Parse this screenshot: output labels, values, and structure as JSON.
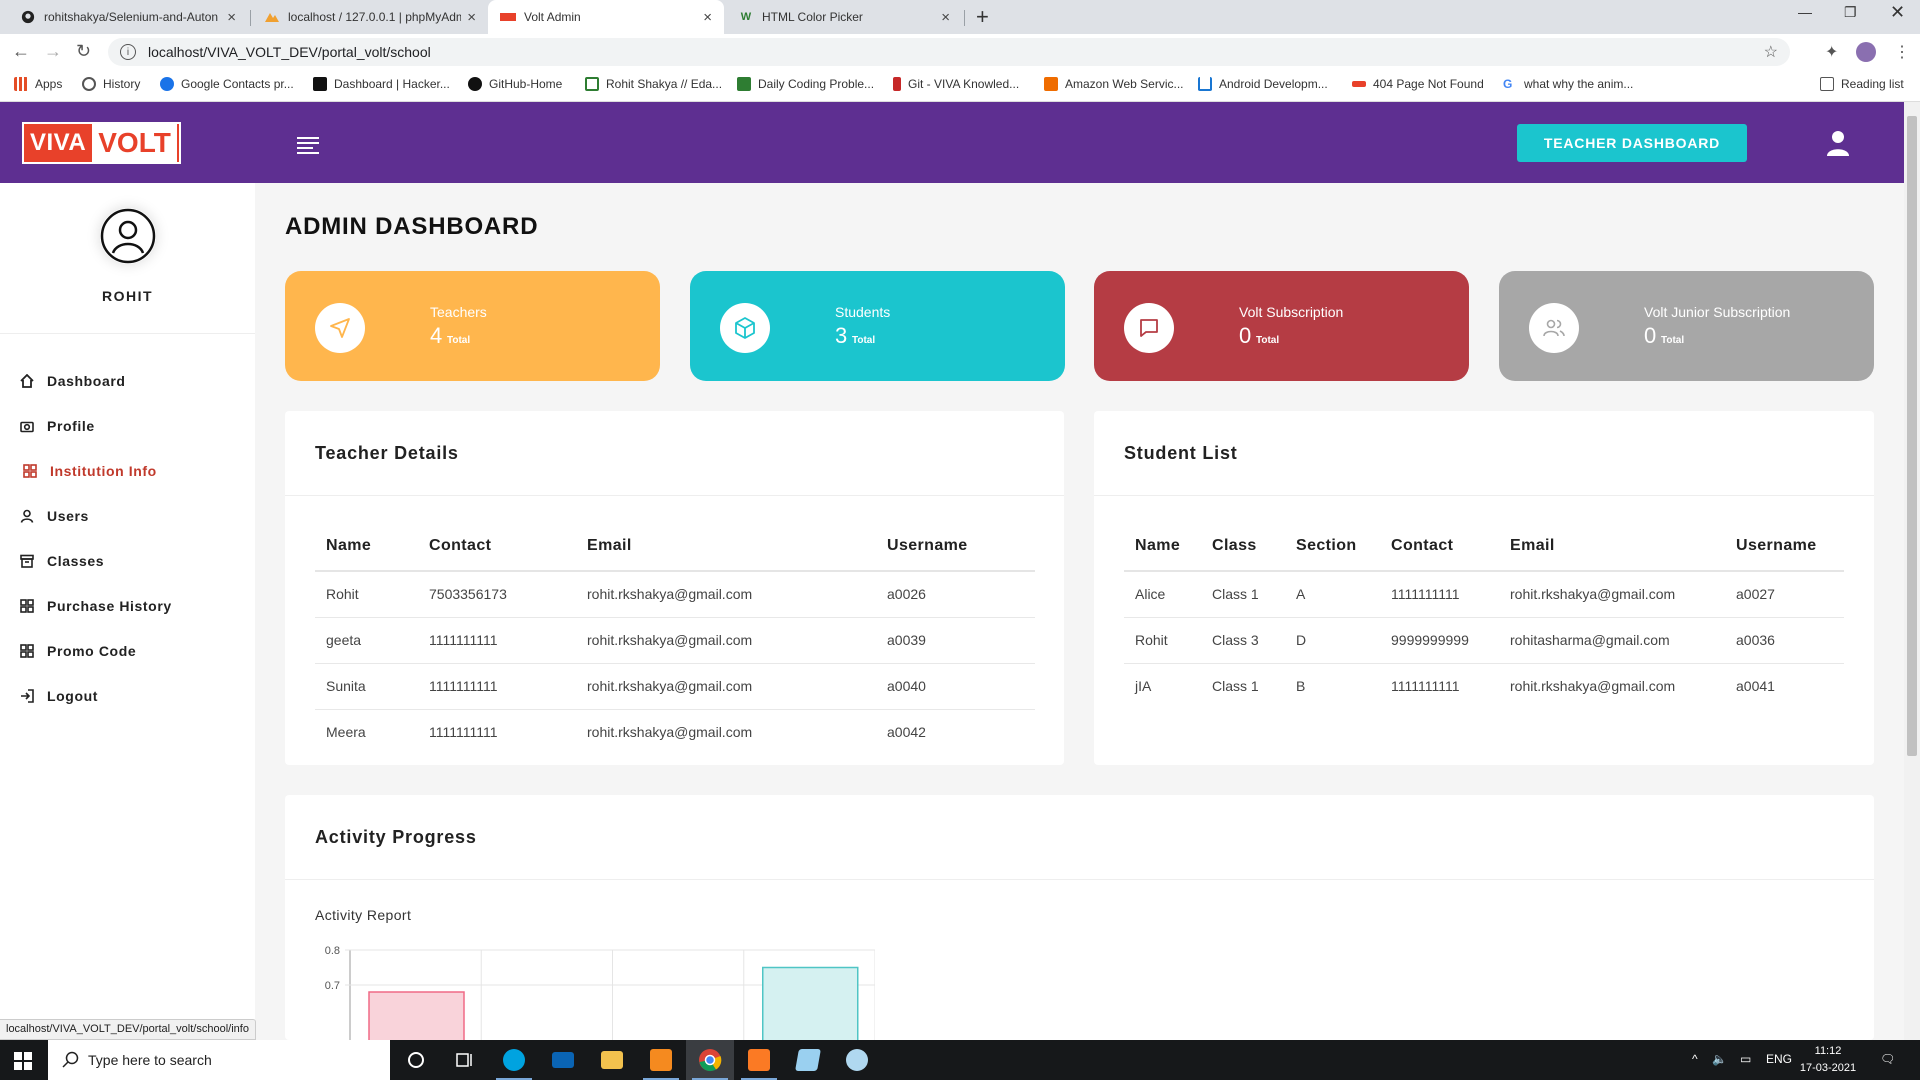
{
  "browser": {
    "tabs": [
      {
        "title": "rohitshakya/Selenium-and-Auton",
        "close": "×"
      },
      {
        "title": "localhost / 127.0.0.1 | phpMyAdm",
        "close": "×"
      },
      {
        "title": "Volt Admin",
        "close": "×"
      },
      {
        "title": "HTML Color Picker",
        "close": "×"
      }
    ],
    "new_tab": "+",
    "url": "localhost/VIVA_VOLT_DEV/portal_volt/school",
    "bookmarks": [
      {
        "label": "Apps",
        "color": "#e44d26"
      },
      {
        "label": "History",
        "color": "#1a73e8"
      },
      {
        "label": "Google Contacts pr...",
        "color": "#1a73e8"
      },
      {
        "label": "Dashboard | Hacker...",
        "color": "#111111"
      },
      {
        "label": "GitHub-Home",
        "color": "#111111"
      },
      {
        "label": "Rohit Shakya // Eda...",
        "color": "#2e7d32"
      },
      {
        "label": "Daily Coding Proble...",
        "color": "#2e7d32"
      },
      {
        "label": "Git - VIVA Knowled...",
        "color": "#c62828"
      },
      {
        "label": "Amazon Web Servic...",
        "color": "#ef6c00"
      },
      {
        "label": "Android Developm...",
        "color": "#1976d2"
      },
      {
        "label": "404 Page Not Found",
        "color": "#e8412a"
      },
      {
        "label": "what why the anim...",
        "color": "#4285f4"
      }
    ],
    "reading_list": "Reading list",
    "status_url": "localhost/VIVA_VOLT_DEV/portal_volt/school/info"
  },
  "header": {
    "logo_viva": "VIVA",
    "logo_volt": "VOLT",
    "teacher_dashboard": "TEACHER DASHBOARD",
    "bg_color": "#5e2f91",
    "button_color": "#1bc5ce"
  },
  "sidebar": {
    "username": "ROHIT",
    "items": [
      {
        "label": "Dashboard",
        "icon": "home-icon"
      },
      {
        "label": "Profile",
        "icon": "camera-icon"
      },
      {
        "label": "Institution Info",
        "icon": "grid-icon",
        "active": true
      },
      {
        "label": "Users",
        "icon": "user-icon"
      },
      {
        "label": "Classes",
        "icon": "archive-icon"
      },
      {
        "label": "Purchase History",
        "icon": "grid-icon"
      },
      {
        "label": "Promo Code",
        "icon": "grid-icon"
      },
      {
        "label": "Logout",
        "icon": "logout-icon"
      }
    ]
  },
  "main": {
    "title": "ADMIN DASHBOARD",
    "cards": [
      {
        "label": "Teachers",
        "value": "4",
        "suffix": "Total",
        "color": "#ffb64d",
        "icon": "send-icon"
      },
      {
        "label": "Students",
        "value": "3",
        "suffix": "Total",
        "color": "#1bc5ce",
        "icon": "box-icon"
      },
      {
        "label": "Volt Subscription",
        "value": "0",
        "suffix": "Total",
        "color": "#b53c44",
        "icon": "message-icon"
      },
      {
        "label": "Volt Junior Subscription",
        "value": "0",
        "suffix": "Total",
        "color": "#a7a7a7",
        "icon": "users-icon"
      }
    ],
    "teacher_details": {
      "title": "Teacher Details",
      "headers": [
        "Name",
        "Contact",
        "Email",
        "Username"
      ],
      "rows": [
        [
          "Rohit",
          "7503356173",
          "rohit.rkshakya@gmail.com",
          "a0026"
        ],
        [
          "geeta",
          "1111111111",
          "rohit.rkshakya@gmail.com",
          "a0039"
        ],
        [
          "Sunita",
          "1111111111",
          "rohit.rkshakya@gmail.com",
          "a0040"
        ],
        [
          "Meera",
          "1111111111",
          "rohit.rkshakya@gmail.com",
          "a0042"
        ]
      ]
    },
    "student_list": {
      "title": "Student List",
      "headers": [
        "Name",
        "Class",
        "Section",
        "Contact",
        "Email",
        "Username"
      ],
      "rows": [
        [
          "Alice",
          "Class 1",
          "A",
          "1111111111",
          "rohit.rkshakya@gmail.com",
          "a0027"
        ],
        [
          "Rohit",
          "Class 3",
          "D",
          "9999999999",
          "rohitasharma@gmail.com",
          "a0036"
        ],
        [
          "jIA",
          "Class 1",
          "B",
          "1111111111",
          "rohit.rkshakya@gmail.com",
          "a0041"
        ]
      ]
    },
    "activity": {
      "title": "Activity Progress",
      "subtitle": "Activity Report"
    }
  },
  "chart_data": {
    "type": "bar",
    "title": "Activity Report",
    "yticks": [
      "0.8",
      "0.7"
    ],
    "ylim": [
      0.6,
      0.8
    ],
    "values": [
      0.68,
      0.75
    ],
    "colors": [
      "#f9d3da",
      "#d5f1f1"
    ],
    "edge_colors": [
      "#f06a86",
      "#4fc5c5"
    ]
  },
  "taskbar": {
    "search_placeholder": "Type here to search",
    "lang": "ENG",
    "time": "11:12",
    "date": "17-03-2021"
  }
}
